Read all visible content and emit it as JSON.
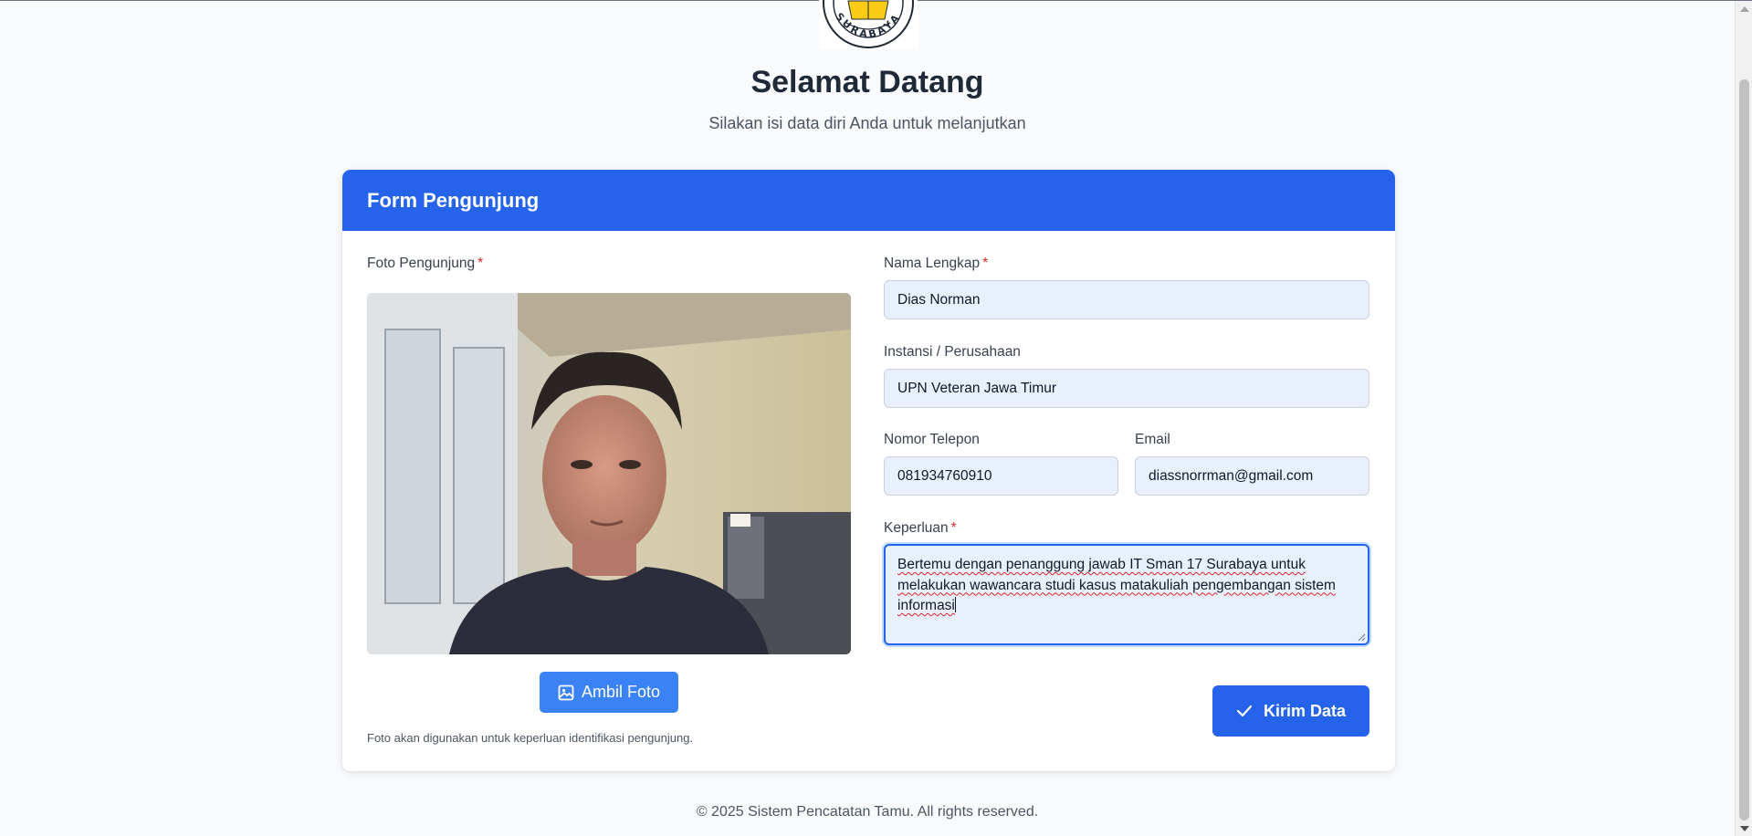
{
  "header": {
    "logo_text": "SURABAYA",
    "title": "Selamat Datang",
    "subtitle": "Silakan isi data diri Anda untuk melanjutkan"
  },
  "form": {
    "card_title": "Form Pengunjung",
    "photo": {
      "label": "Foto Pengunjung",
      "required_mark": "*",
      "take_photo_button": "Ambil Foto",
      "hint": "Foto akan digunakan untuk keperluan identifikasi pengunjung."
    },
    "fields": {
      "full_name": {
        "label": "Nama Lengkap",
        "required_mark": "*",
        "value": "Dias Norman"
      },
      "institution": {
        "label": "Instansi / Perusahaan",
        "value": "UPN Veteran Jawa Timur"
      },
      "phone": {
        "label": "Nomor Telepon",
        "value": "081934760910"
      },
      "email": {
        "label": "Email",
        "value": "diassnorrman@gmail.com"
      },
      "purpose": {
        "label": "Keperluan",
        "required_mark": "*",
        "value": "Bertemu dengan penanggung jawab IT Sman 17 Surabaya untuk melakukan wawancara studi kasus matakuliah pengembangan sistem informasi"
      }
    },
    "submit_button": "Kirim Data"
  },
  "footer": {
    "copyright": "© 2025 Sistem Pencatatan Tamu. All rights reserved."
  },
  "colors": {
    "primary": "#2563eb",
    "secondary_button": "#3b82f6",
    "input_bg": "#e8f0fe",
    "required": "#dc2626",
    "page_bg": "#f8fafc"
  }
}
